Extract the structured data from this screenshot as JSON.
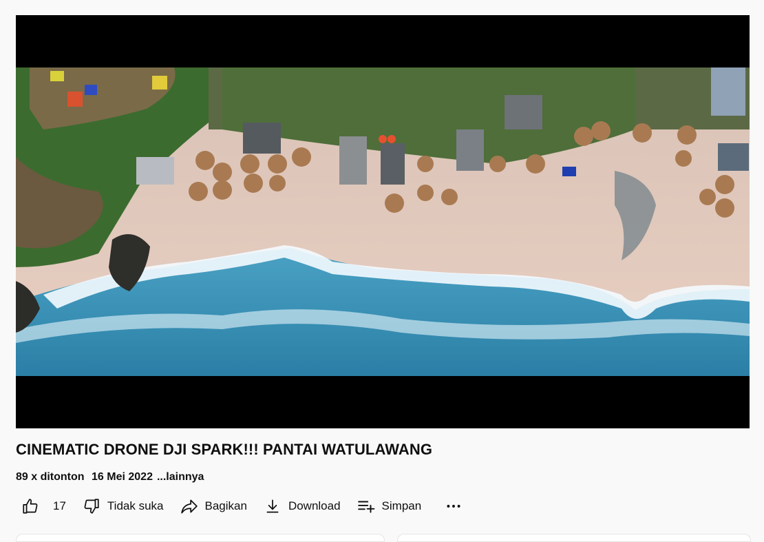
{
  "video": {
    "title": "CINEMATIC DRONE DJI SPARK!!! PANTAI WATULAWANG",
    "views": "89 x ditonton",
    "date": "16 Mei 2022",
    "more_label": "...lainnya",
    "thumbnail_description": "aerial beach scene"
  },
  "actions": {
    "like_count": "17",
    "dislike_label": "Tidak suka",
    "share_label": "Bagikan",
    "download_label": "Download",
    "save_label": "Simpan"
  },
  "icons": {
    "like": "thumbs-up-icon",
    "dislike": "thumbs-down-icon",
    "share": "share-arrow-icon",
    "download": "download-icon",
    "save": "playlist-add-icon",
    "more": "more-horizontal-icon"
  }
}
